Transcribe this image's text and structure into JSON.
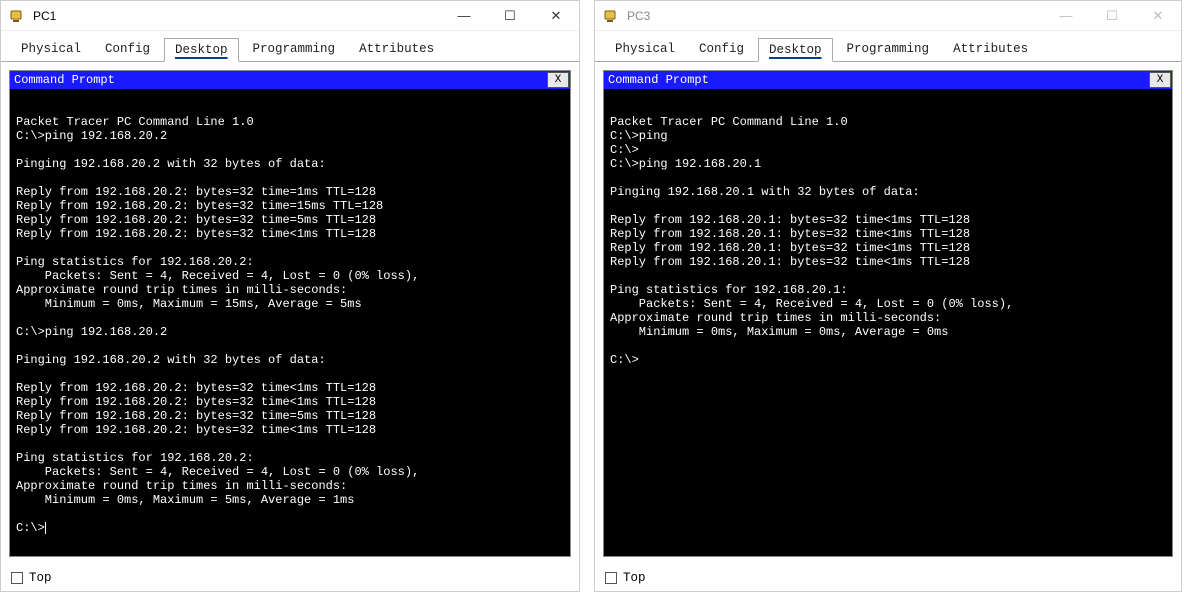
{
  "windows": [
    {
      "id": "pc1",
      "title": "PC1",
      "active": true,
      "tabs": [
        "Physical",
        "Config",
        "Desktop",
        "Programming",
        "Attributes"
      ],
      "active_tab": "Desktop",
      "prompt_title": "Command Prompt",
      "prompt_close": "X",
      "top_label": "Top",
      "terminal": "\nPacket Tracer PC Command Line 1.0\nC:\\>ping 192.168.20.2\n\nPinging 192.168.20.2 with 32 bytes of data:\n\nReply from 192.168.20.2: bytes=32 time=1ms TTL=128\nReply from 192.168.20.2: bytes=32 time=15ms TTL=128\nReply from 192.168.20.2: bytes=32 time=5ms TTL=128\nReply from 192.168.20.2: bytes=32 time<1ms TTL=128\n\nPing statistics for 192.168.20.2:\n    Packets: Sent = 4, Received = 4, Lost = 0 (0% loss),\nApproximate round trip times in milli-seconds:\n    Minimum = 0ms, Maximum = 15ms, Average = 5ms\n\nC:\\>ping 192.168.20.2\n\nPinging 192.168.20.2 with 32 bytes of data:\n\nReply from 192.168.20.2: bytes=32 time<1ms TTL=128\nReply from 192.168.20.2: bytes=32 time<1ms TTL=128\nReply from 192.168.20.2: bytes=32 time=5ms TTL=128\nReply from 192.168.20.2: bytes=32 time<1ms TTL=128\n\nPing statistics for 192.168.20.2:\n    Packets: Sent = 4, Received = 4, Lost = 0 (0% loss),\nApproximate round trip times in milli-seconds:\n    Minimum = 0ms, Maximum = 5ms, Average = 1ms\n\nC:\\>"
    },
    {
      "id": "pc3",
      "title": "PC3",
      "active": false,
      "tabs": [
        "Physical",
        "Config",
        "Desktop",
        "Programming",
        "Attributes"
      ],
      "active_tab": "Desktop",
      "prompt_title": "Command Prompt",
      "prompt_close": "X",
      "top_label": "Top",
      "terminal": "\nPacket Tracer PC Command Line 1.0\nC:\\>ping\nC:\\>\nC:\\>ping 192.168.20.1\n\nPinging 192.168.20.1 with 32 bytes of data:\n\nReply from 192.168.20.1: bytes=32 time<1ms TTL=128\nReply from 192.168.20.1: bytes=32 time<1ms TTL=128\nReply from 192.168.20.1: bytes=32 time<1ms TTL=128\nReply from 192.168.20.1: bytes=32 time<1ms TTL=128\n\nPing statistics for 192.168.20.1:\n    Packets: Sent = 4, Received = 4, Lost = 0 (0% loss),\nApproximate round trip times in milli-seconds:\n    Minimum = 0ms, Maximum = 0ms, Average = 0ms\n\nC:\\>"
    }
  ],
  "controls": {
    "min": "—",
    "max": "☐",
    "close": "✕"
  }
}
